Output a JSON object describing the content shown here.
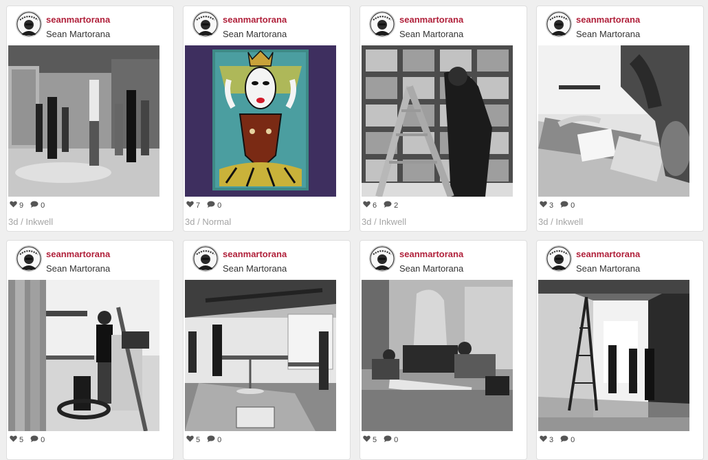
{
  "cards": [
    {
      "username": "seanmartorana",
      "fullname": "Sean Martorana",
      "likes": "9",
      "comments": "0",
      "age": "3d",
      "filter": "Inkwell",
      "scene": "studio-group"
    },
    {
      "username": "seanmartorana",
      "fullname": "Sean Martorana",
      "likes": "7",
      "comments": "0",
      "age": "3d",
      "filter": "Normal",
      "scene": "painting"
    },
    {
      "username": "seanmartorana",
      "fullname": "Sean Martorana",
      "likes": "6",
      "comments": "2",
      "age": "3d",
      "filter": "Inkwell",
      "scene": "ladder-window"
    },
    {
      "username": "seanmartorana",
      "fullname": "Sean Martorana",
      "likes": "3",
      "comments": "0",
      "age": "3d",
      "filter": "Inkwell",
      "scene": "table-papers"
    },
    {
      "username": "seanmartorana",
      "fullname": "Sean Martorana",
      "likes": "5",
      "comments": "0",
      "age": "",
      "filter": "",
      "scene": "workshop-man"
    },
    {
      "username": "seanmartorana",
      "fullname": "Sean Martorana",
      "likes": "5",
      "comments": "0",
      "age": "",
      "filter": "",
      "scene": "gallery-room"
    },
    {
      "username": "seanmartorana",
      "fullname": "Sean Martorana",
      "likes": "5",
      "comments": "0",
      "age": "",
      "filter": "",
      "scene": "floor-work"
    },
    {
      "username": "seanmartorana",
      "fullname": "Sean Martorana",
      "likes": "3",
      "comments": "0",
      "age": "",
      "filter": "",
      "scene": "hallway-ladder"
    }
  ],
  "meta_separator": "/",
  "colors": {
    "username": "#b0203a",
    "meta": "#a5a5a5",
    "background": "#efefef"
  },
  "icons": {
    "likes": "heart-icon",
    "comments": "speech-bubble-icon"
  }
}
